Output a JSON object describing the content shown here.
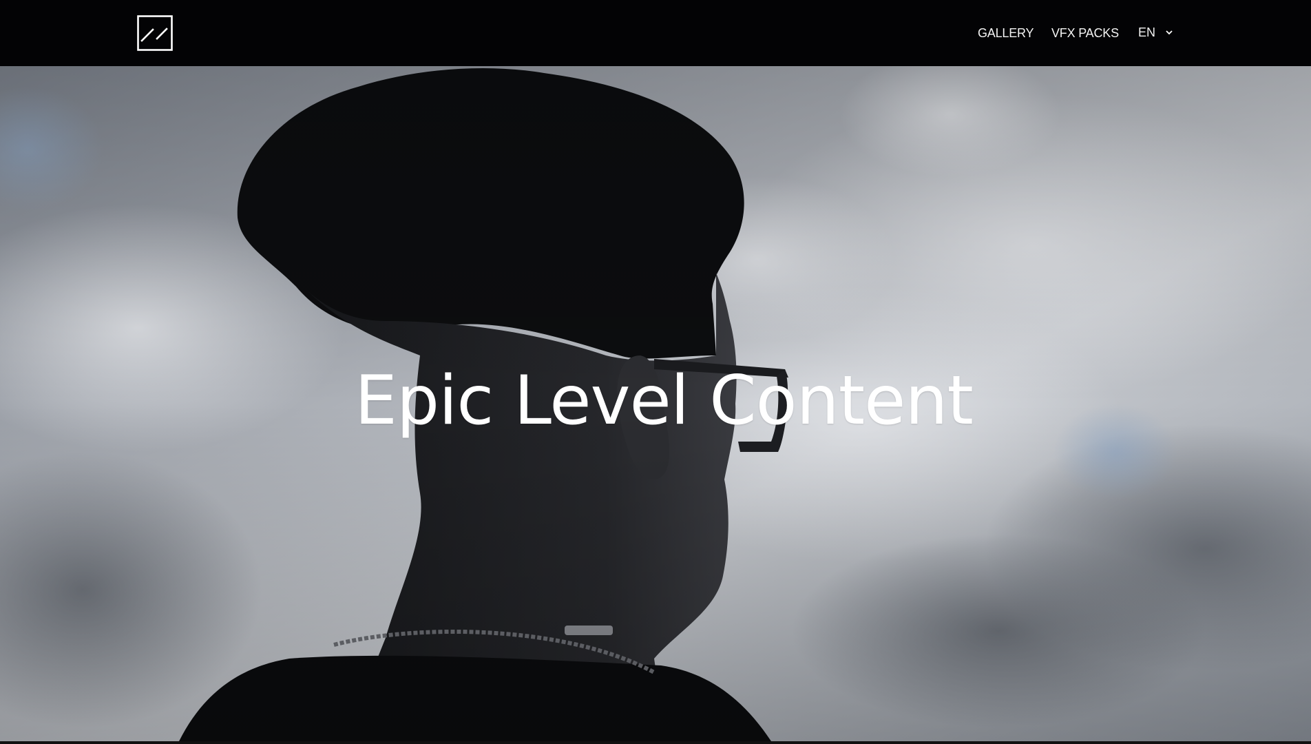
{
  "header": {
    "logo_icon": "square-slash-logo-icon",
    "nav": {
      "gallery": "GALLERY",
      "vfx_packs": "VFX PACKS"
    },
    "language": {
      "selected": "EN",
      "chevron_icon": "chevron-down-icon"
    }
  },
  "hero": {
    "title": "Epic Level Content",
    "background": "silhouette-portrait-against-cloudy-sky"
  },
  "colors": {
    "header_bg": "#030305",
    "text": "#ffffff",
    "sky_light": "#c9ccd1",
    "sky_mid": "#9aa0a8",
    "silhouette": "#0d0e10"
  }
}
